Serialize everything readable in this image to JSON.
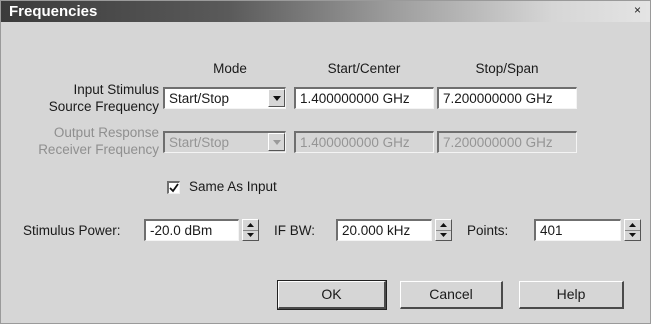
{
  "window": {
    "title": "Frequencies",
    "close_glyph": "×",
    "close_icon": "close-icon"
  },
  "headers": {
    "mode": "Mode",
    "start_center": "Start/Center",
    "stop_span": "Stop/Span"
  },
  "input_stimulus": {
    "label_line1": "Input Stimulus",
    "label_line2": "Source Frequency",
    "mode": "Start/Stop",
    "start": "1.400000000 GHz",
    "stop": "7.200000000 GHz"
  },
  "output_response": {
    "label_line1": "Output Response",
    "label_line2": "Receiver Frequency",
    "mode": "Start/Stop",
    "start": "1.400000000 GHz",
    "stop": "7.200000000 GHz",
    "enabled": false
  },
  "same_as_input": {
    "label": "Same As Input",
    "checked": true
  },
  "stimulus_power": {
    "label": "Stimulus Power:",
    "value": "-20.0 dBm"
  },
  "if_bw": {
    "label": "IF BW:",
    "value": "20.000 kHz"
  },
  "points": {
    "label": "Points:",
    "value": "401"
  },
  "buttons": {
    "ok": "OK",
    "cancel": "Cancel",
    "help": "Help"
  }
}
